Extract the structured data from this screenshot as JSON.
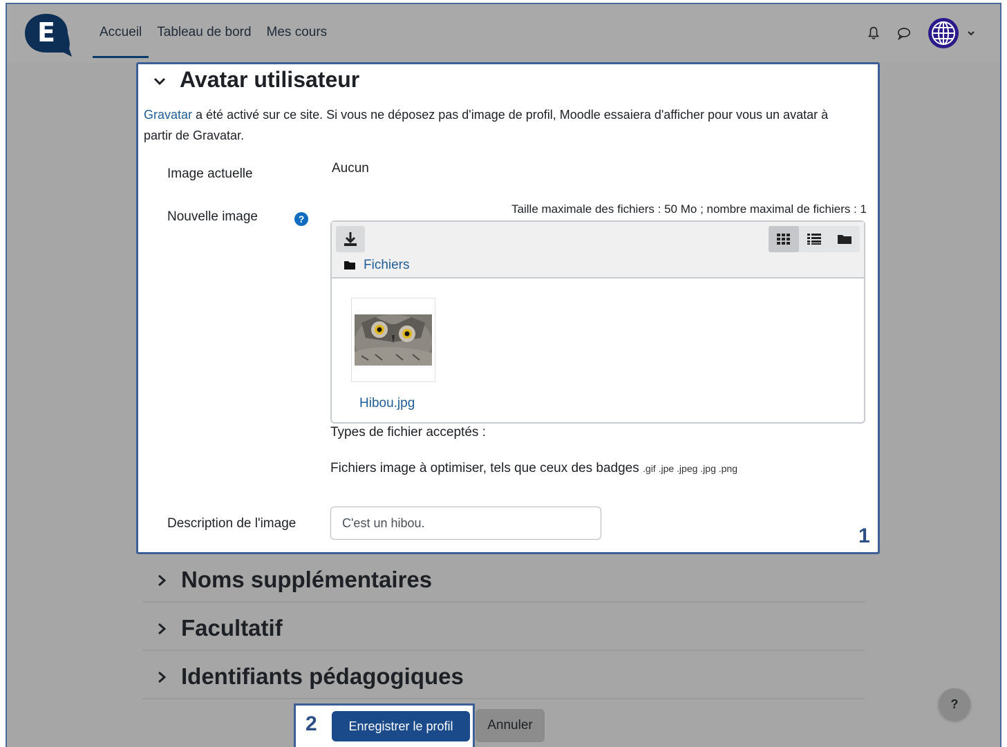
{
  "navbar": {
    "links": [
      "Accueil",
      "Tableau de bord",
      "Mes cours"
    ],
    "active_link": "Accueil",
    "logo_letter": "E",
    "icons": [
      "bell-icon",
      "chat-icon",
      "globe-avatar-icon",
      "chevron-down-icon"
    ]
  },
  "avatar_section": {
    "title": "Avatar utilisateur",
    "intro_link": "Gravatar",
    "intro_text": " a été activé sur ce site. Si vous ne déposez pas d'image de profil, Moodle essaiera d'afficher pour vous un avatar à partir de Gravatar.",
    "current_image_label": "Image actuelle",
    "current_image_value": "Aucun",
    "new_image_label": "Nouvelle image",
    "help_glyph": "?",
    "limits": "Taille maximale des fichiers : 50 Mo ; nombre maximal de fichiers : 1",
    "file_path": "Fichiers",
    "file_name": "Hibou.jpg",
    "accepted_title": "Types de fichier acceptés :",
    "accepted_desc": "Fichiers image à optimiser, tels que ceux des badges",
    "accepted_ext": ".gif .jpe .jpeg .jpg .png",
    "description_label": "Description de l'image",
    "description_value": "C'est un hibou.",
    "marker": "1"
  },
  "sections": [
    {
      "title": "Noms supplémentaires"
    },
    {
      "title": "Facultatif"
    },
    {
      "title": "Identifiants pédagogiques"
    }
  ],
  "footer": {
    "marker": "2",
    "save_label": "Enregistrer le profil",
    "cancel_label": "Annuler",
    "help_label": "?"
  },
  "colors": {
    "primary": "#1a4a8a",
    "link": "#1f5d96",
    "highlight_border": "#3d5f95",
    "overlay_gray": "#a6a6a6"
  }
}
